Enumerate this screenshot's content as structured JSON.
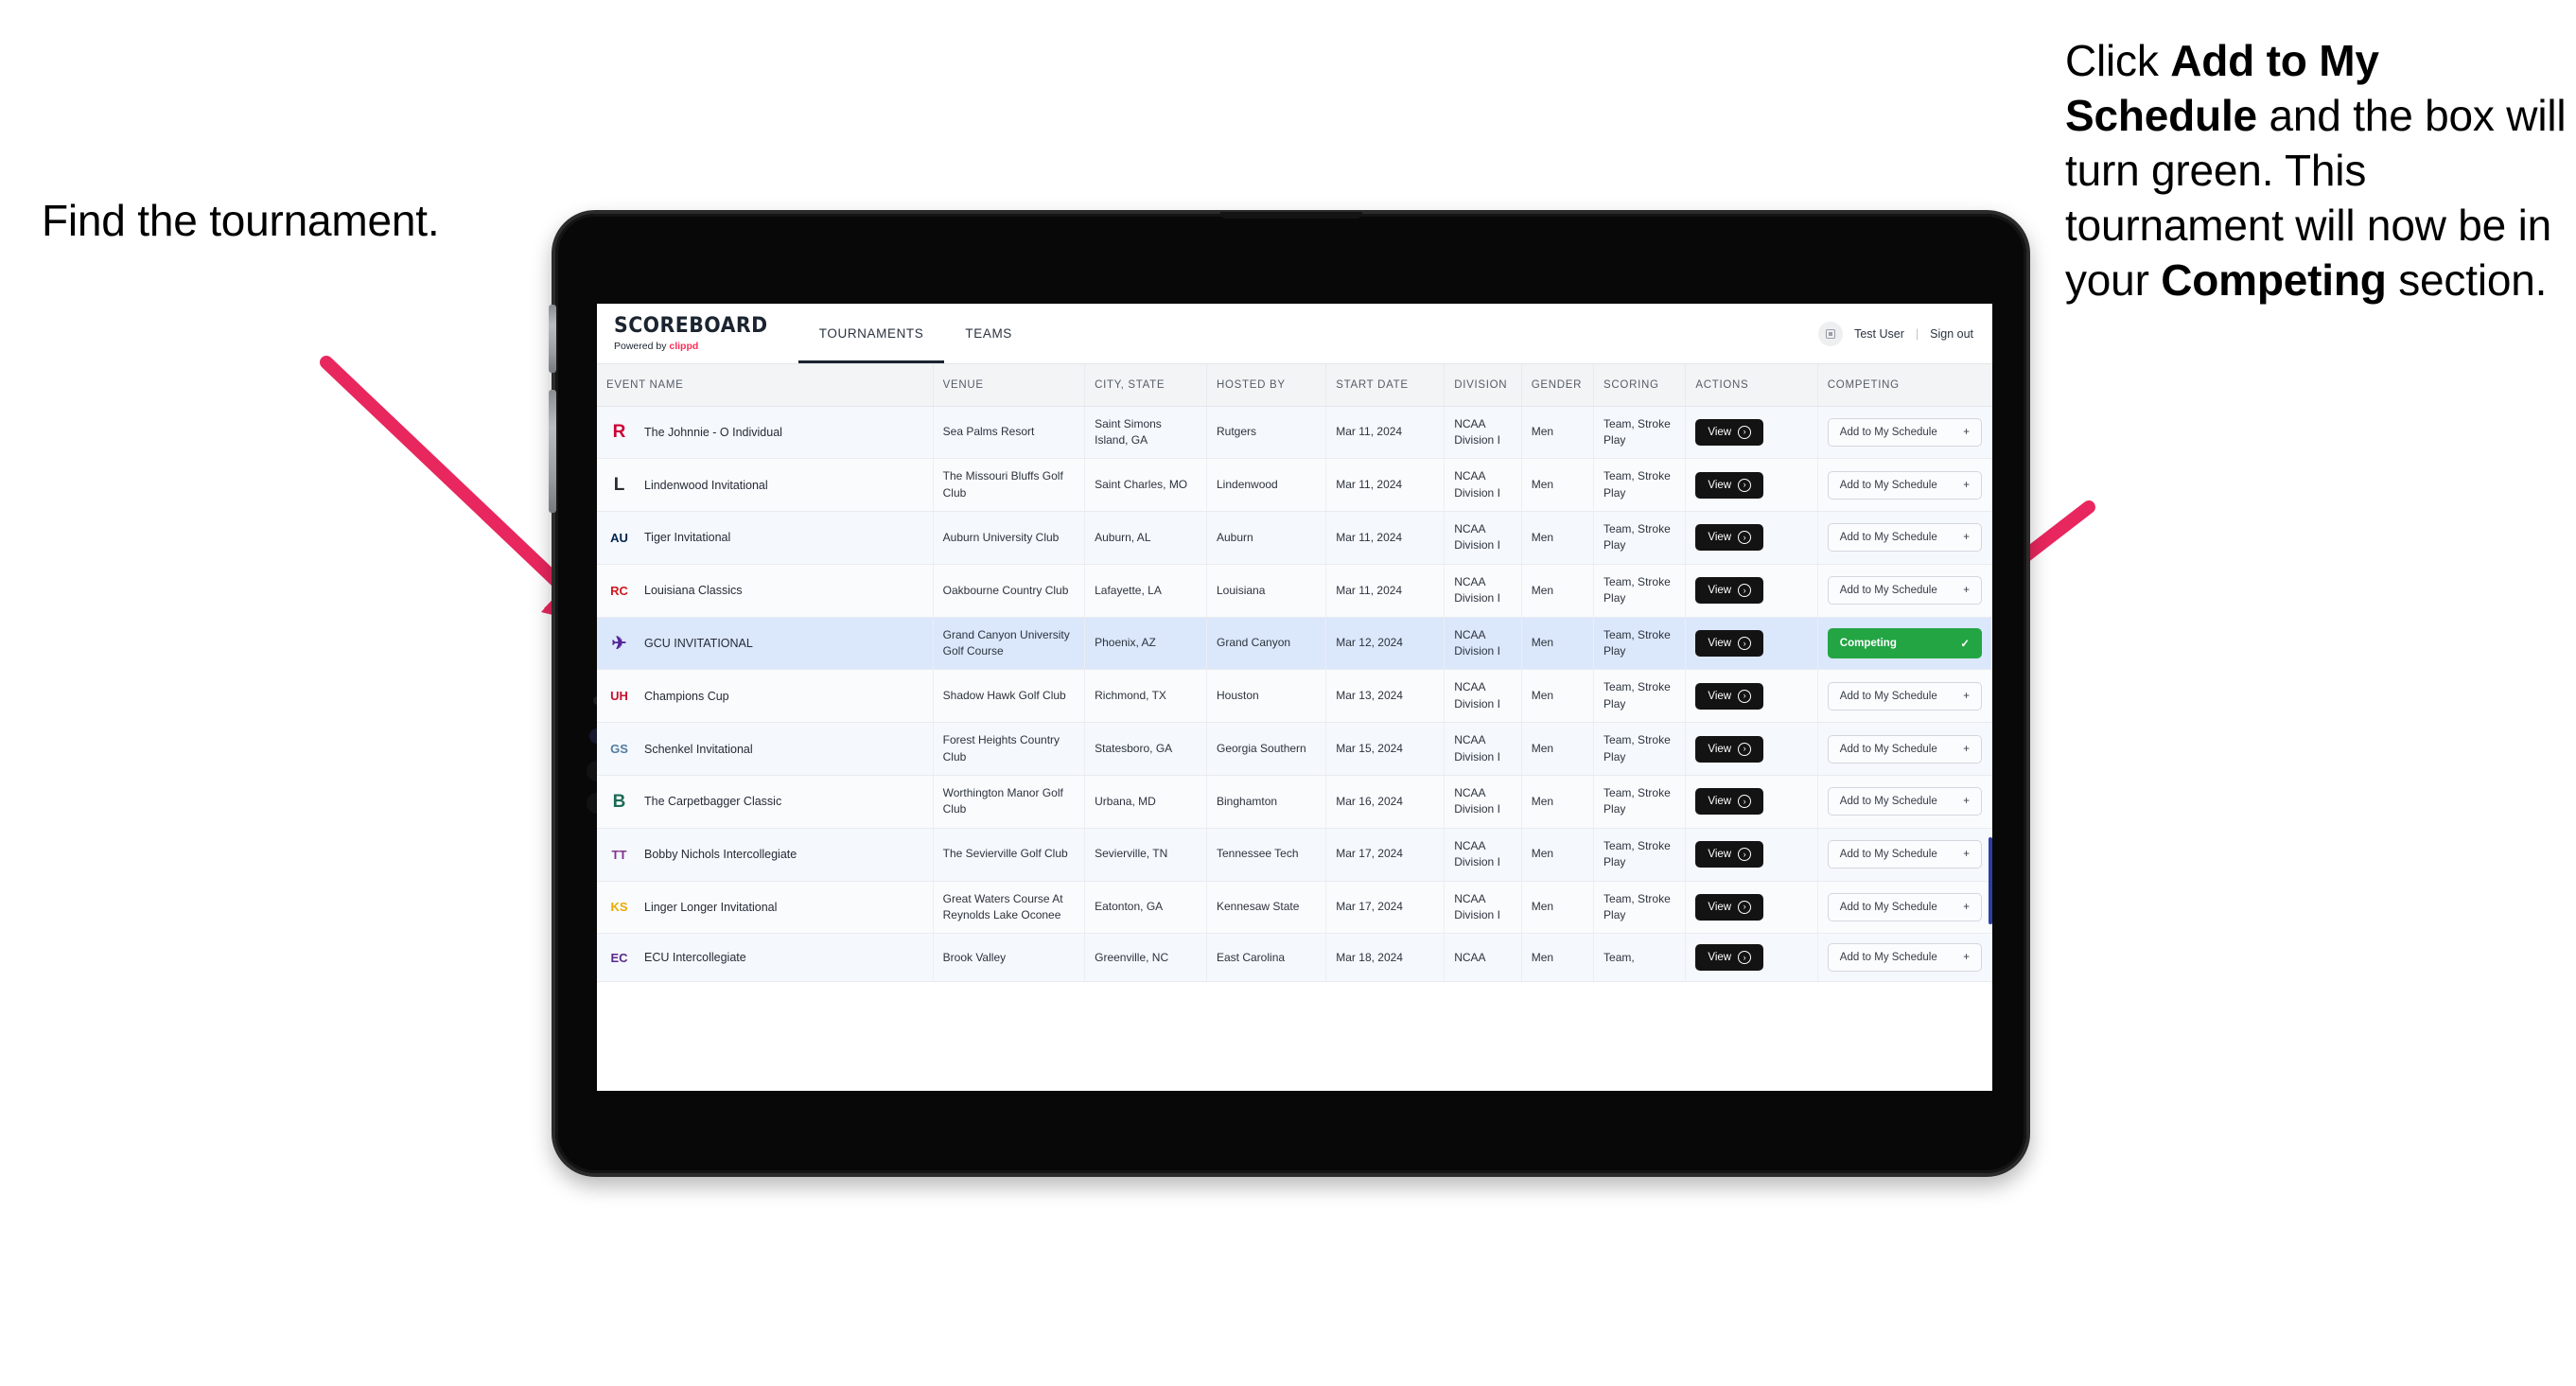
{
  "annotations": {
    "left": "Find the tournament.",
    "right_parts": [
      {
        "text": "Click ",
        "bold": false
      },
      {
        "text": "Add to My Schedule",
        "bold": true
      },
      {
        "text": " and the box will turn green. This tournament will now be in your ",
        "bold": false
      },
      {
        "text": "Competing",
        "bold": true
      },
      {
        "text": " section.",
        "bold": false
      }
    ],
    "arrow_color": "#e8275e"
  },
  "app": {
    "brand": {
      "name": "SCOREBOARD",
      "powered_prefix": "Powered by ",
      "powered_brand": "clippd"
    },
    "nav_tabs": [
      {
        "label": "TOURNAMENTS",
        "active": true
      },
      {
        "label": "TEAMS",
        "active": false
      }
    ],
    "user": {
      "avatar_icon": "user-avatar-icon",
      "name": "Test User",
      "separator": "|",
      "sign_out": "Sign out"
    },
    "table": {
      "columns": [
        "EVENT NAME",
        "VENUE",
        "CITY, STATE",
        "HOSTED BY",
        "START DATE",
        "DIVISION",
        "GENDER",
        "SCORING",
        "ACTIONS",
        "COMPETING"
      ],
      "view_label": "View",
      "add_label": "Add to My Schedule",
      "add_icon": "plus-icon",
      "competing_label": "Competing",
      "competing_icon": "check-icon",
      "competing_color": "#23a544",
      "rows": [
        {
          "logo": {
            "text": "R",
            "color": "#cc0033",
            "bg": "transparent"
          },
          "event": "The Johnnie - O Individual",
          "venue": "Sea Palms Resort",
          "city": "Saint Simons Island, GA",
          "hosted_by": "Rutgers",
          "start_date": "Mar 11, 2024",
          "division": "NCAA Division I",
          "gender": "Men",
          "scoring": "Team, Stroke Play",
          "competing": false
        },
        {
          "logo": {
            "text": "L",
            "color": "#2b2b2b",
            "bg": "transparent"
          },
          "event": "Lindenwood Invitational",
          "venue": "The Missouri Bluffs Golf Club",
          "city": "Saint Charles, MO",
          "hosted_by": "Lindenwood",
          "start_date": "Mar 11, 2024",
          "division": "NCAA Division I",
          "gender": "Men",
          "scoring": "Team, Stroke Play",
          "competing": false
        },
        {
          "logo": {
            "text": "AU",
            "color": "#03244d",
            "bg": "transparent"
          },
          "event": "Tiger Invitational",
          "venue": "Auburn University Club",
          "city": "Auburn, AL",
          "hosted_by": "Auburn",
          "start_date": "Mar 11, 2024",
          "division": "NCAA Division I",
          "gender": "Men",
          "scoring": "Team, Stroke Play",
          "competing": false
        },
        {
          "logo": {
            "text": "RC",
            "color": "#ce181e",
            "bg": "transparent"
          },
          "event": "Louisiana Classics",
          "venue": "Oakbourne Country Club",
          "city": "Lafayette, LA",
          "hosted_by": "Louisiana",
          "start_date": "Mar 11, 2024",
          "division": "NCAA Division I",
          "gender": "Men",
          "scoring": "Team, Stroke Play",
          "competing": false
        },
        {
          "logo": {
            "text": "✈",
            "color": "#522398",
            "bg": "transparent"
          },
          "event": "GCU INVITATIONAL",
          "venue": "Grand Canyon University Golf Course",
          "city": "Phoenix, AZ",
          "hosted_by": "Grand Canyon",
          "start_date": "Mar 12, 2024",
          "division": "NCAA Division I",
          "gender": "Men",
          "scoring": "Team, Stroke Play",
          "competing": true
        },
        {
          "logo": {
            "text": "UH",
            "color": "#c8102e",
            "bg": "transparent"
          },
          "event": "Champions Cup",
          "venue": "Shadow Hawk Golf Club",
          "city": "Richmond, TX",
          "hosted_by": "Houston",
          "start_date": "Mar 13, 2024",
          "division": "NCAA Division I",
          "gender": "Men",
          "scoring": "Team, Stroke Play",
          "competing": false
        },
        {
          "logo": {
            "text": "GS",
            "color": "#527ca0",
            "bg": "transparent"
          },
          "event": "Schenkel Invitational",
          "venue": "Forest Heights Country Club",
          "city": "Statesboro, GA",
          "hosted_by": "Georgia Southern",
          "start_date": "Mar 15, 2024",
          "division": "NCAA Division I",
          "gender": "Men",
          "scoring": "Team, Stroke Play",
          "competing": false
        },
        {
          "logo": {
            "text": "B",
            "color": "#1b6b56",
            "bg": "transparent"
          },
          "event": "The Carpetbagger Classic",
          "venue": "Worthington Manor Golf Club",
          "city": "Urbana, MD",
          "hosted_by": "Binghamton",
          "start_date": "Mar 16, 2024",
          "division": "NCAA Division I",
          "gender": "Men",
          "scoring": "Team, Stroke Play",
          "competing": false
        },
        {
          "logo": {
            "text": "TT",
            "color": "#82348c",
            "bg": "transparent"
          },
          "event": "Bobby Nichols Intercollegiate",
          "venue": "The Sevierville Golf Club",
          "city": "Sevierville, TN",
          "hosted_by": "Tennessee Tech",
          "start_date": "Mar 17, 2024",
          "division": "NCAA Division I",
          "gender": "Men",
          "scoring": "Team, Stroke Play",
          "competing": false
        },
        {
          "logo": {
            "text": "KS",
            "color": "#edaa00",
            "bg": "transparent"
          },
          "event": "Linger Longer Invitational",
          "venue": "Great Waters Course At Reynolds Lake Oconee",
          "city": "Eatonton, GA",
          "hosted_by": "Kennesaw State",
          "start_date": "Mar 17, 2024",
          "division": "NCAA Division I",
          "gender": "Men",
          "scoring": "Team, Stroke Play",
          "competing": false
        },
        {
          "logo": {
            "text": "EC",
            "color": "#592a8a",
            "bg": "transparent"
          },
          "event": "ECU Intercollegiate",
          "venue": "Brook Valley",
          "city": "Greenville, NC",
          "hosted_by": "East Carolina",
          "start_date": "Mar 18, 2024",
          "division": "NCAA",
          "gender": "Men",
          "scoring": "Team,",
          "competing": false,
          "partial": true
        }
      ]
    }
  }
}
